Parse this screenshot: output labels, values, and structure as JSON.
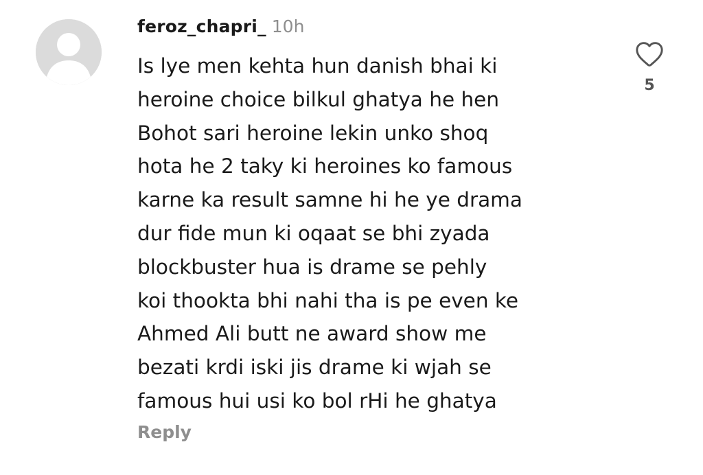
{
  "comment": {
    "username": "feroz_chapri_",
    "timestamp": "10h",
    "text_lines": [
      "Is lye men kehta hun danish bhai ki",
      "heroine choice bilkul ghatya he hen",
      "Bohot sari heroine lekin unko shoq",
      "hota he 2 taky ki heroines ko famous",
      "karne ka result samne hi he ye drama",
      "dur fide mun ki oqaat se bhi zyada",
      "blockbuster hua is drame se pehly",
      "koi thookta bhi nahi tha is pe even ke",
      "Ahmed Ali butt ne award show me",
      "bezati krdi iski jis drame ki wjah se",
      "famous hui usi ko bol rHi he ghatya"
    ],
    "reply_label": "Reply",
    "like_count": "5",
    "avatar_icon": "default-avatar-icon",
    "like_icon": "heart-outline-icon",
    "colors": {
      "text": "#1a1a1a",
      "muted": "#8e8e8e",
      "avatar_bg": "#dbdbdb",
      "avatar_fg": "#ffffff"
    }
  }
}
